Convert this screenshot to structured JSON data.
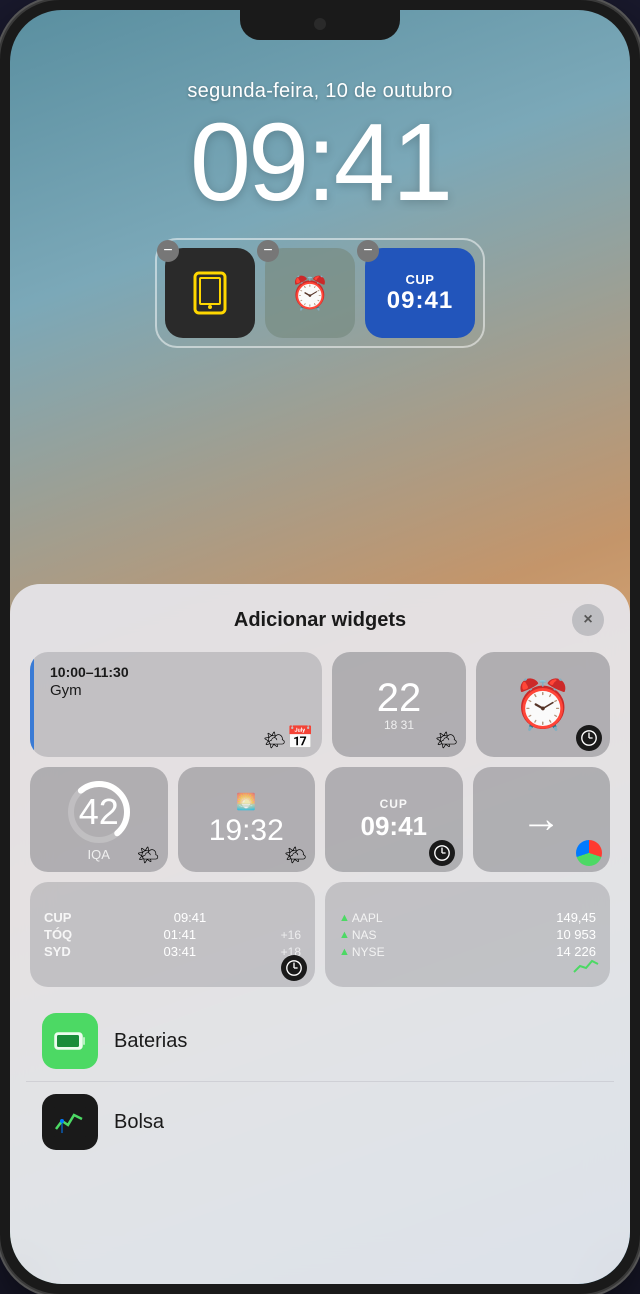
{
  "phone": {
    "status_time": "09:41",
    "date_label": "segunda-feira, 10 de outubro",
    "time_display": "09:41"
  },
  "lock_widgets": {
    "phone_widget_label": "phone",
    "alarm_widget_label": "alarm",
    "cup_widget": {
      "label": "CUP",
      "time": "09:41"
    }
  },
  "panel": {
    "title": "Adicionar widgets",
    "close_label": "×"
  },
  "grid": {
    "row1": {
      "calendar": {
        "time_range": "10:00–11:30",
        "event": "Gym"
      },
      "number_widget": {
        "big_num": "22",
        "sub_nums": "18  31"
      },
      "alarm_widget": {
        "icon": "🕐"
      }
    },
    "row2": {
      "iqa": {
        "num": "42",
        "label": "IQA"
      },
      "time_w": {
        "time": "19:32"
      },
      "cup_w": {
        "label": "CUP",
        "time": "09:41"
      },
      "arrow_w": {
        "icon": "→"
      }
    },
    "row3": {
      "clocks": [
        {
          "code": "CUP",
          "time": "09:41",
          "diff": ""
        },
        {
          "code": "TÓQ",
          "time": "01:41",
          "diff": "+16"
        },
        {
          "code": "SYD",
          "time": "03:41",
          "diff": "+18"
        }
      ],
      "markets": [
        {
          "name": "AAPL",
          "value": "149,45"
        },
        {
          "name": "NAS",
          "value": "10 953"
        },
        {
          "name": "NYSE",
          "value": "14 226"
        }
      ]
    }
  },
  "apps": [
    {
      "name": "Baterias",
      "icon_type": "battery"
    },
    {
      "name": "Bolsa",
      "icon_type": "stocks"
    }
  ]
}
